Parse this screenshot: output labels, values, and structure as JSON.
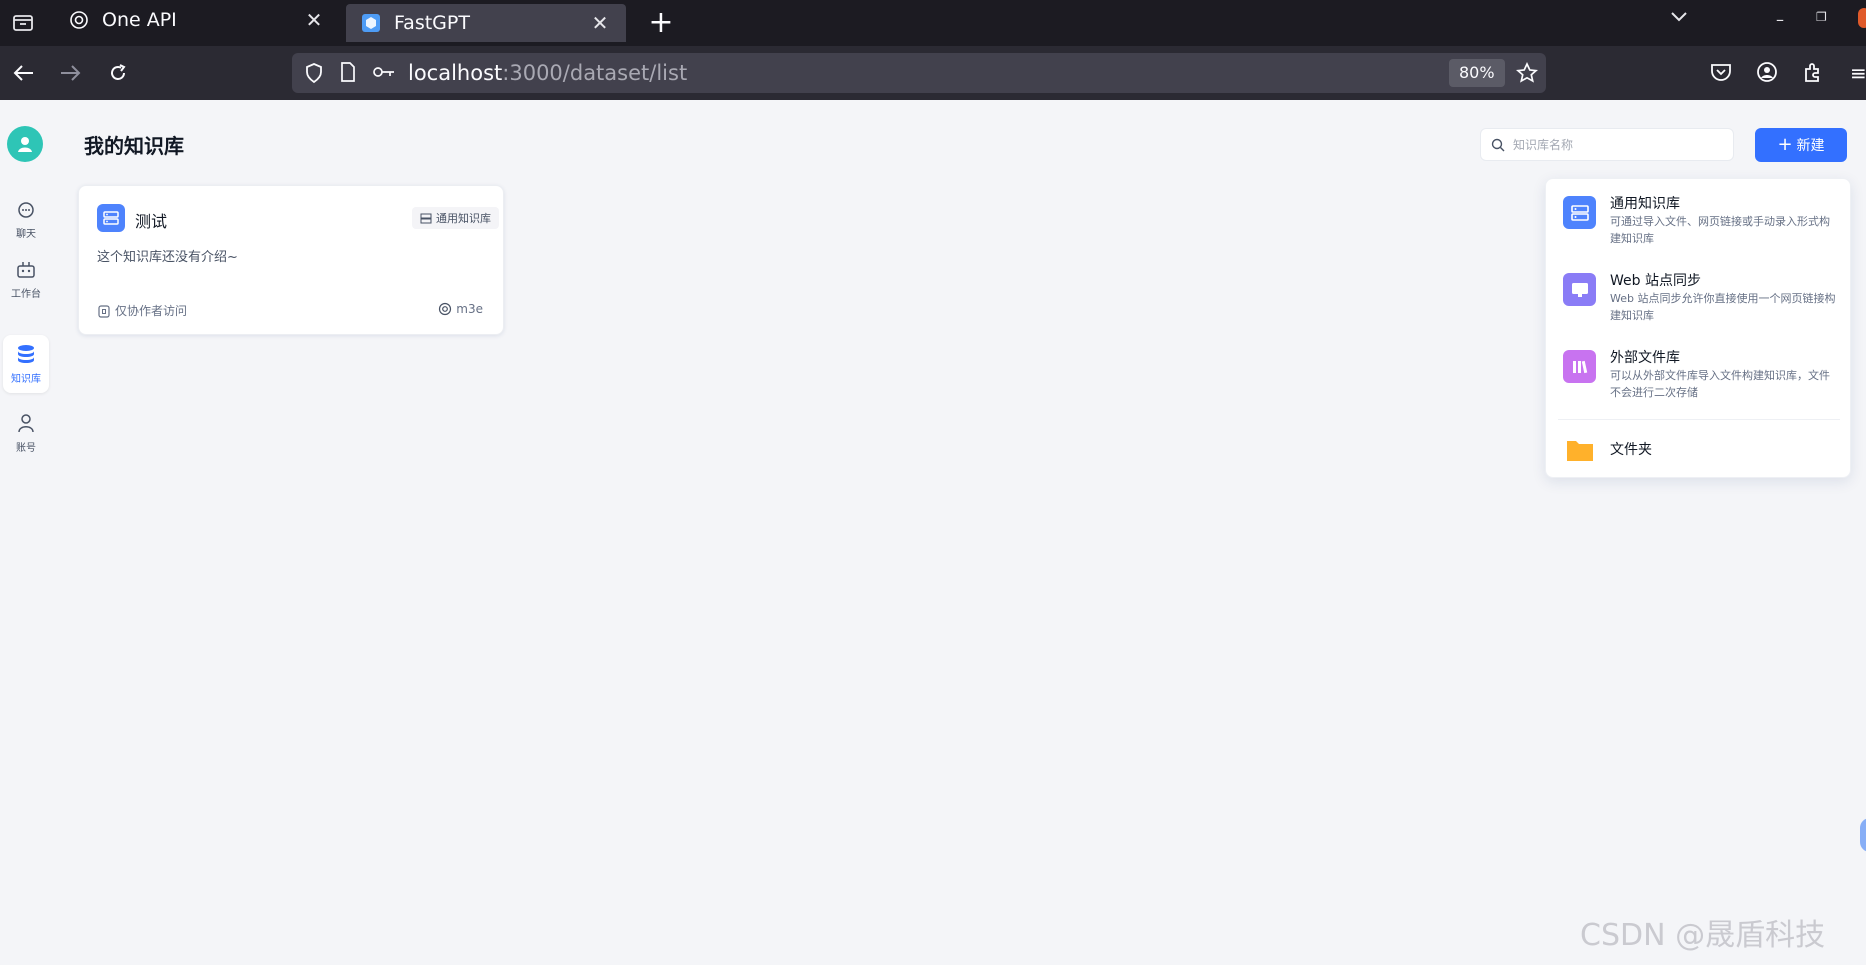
{
  "browser": {
    "tabs": [
      {
        "label": "One API",
        "icon": "openai-icon",
        "active": false
      },
      {
        "label": "FastGPT",
        "icon": "fastgpt-icon",
        "active": true
      }
    ],
    "url_host": "localhost",
    "url_path": ":3000/dataset/list",
    "zoom": "80%"
  },
  "sidebar": {
    "items": [
      {
        "label": "聊天",
        "icon": "chat-icon"
      },
      {
        "label": "工作台",
        "icon": "robot-icon"
      },
      {
        "label": "知识库",
        "icon": "database-icon",
        "active": true
      },
      {
        "label": "账号",
        "icon": "user-icon"
      }
    ]
  },
  "main": {
    "title": "我的知识库",
    "search_placeholder": "知识库名称",
    "new_button": "新建",
    "cards": [
      {
        "name": "测试",
        "tag": "通用知识库",
        "description": "这个知识库还没有介绍~",
        "permission": "仅协作者访问",
        "model": "m3e"
      }
    ]
  },
  "create_menu": {
    "items": [
      {
        "title": "通用知识库",
        "description": "可通过导入文件、网页链接或手动录入形式构建知识库",
        "icon": "dataset-icon",
        "color": "#4e83fd"
      },
      {
        "title": "Web 站点同步",
        "description": "Web 站点同步允许你直接使用一个网页链接构建知识库",
        "icon": "monitor-icon",
        "color": "#8a7cf6"
      },
      {
        "title": "外部文件库",
        "description": "可以从外部文件库导入文件构建知识库，文件不会进行二次存储",
        "icon": "library-icon",
        "color": "#c873f0"
      },
      {
        "title": "文件夹",
        "icon": "folder-icon",
        "color": "#ffb12b"
      }
    ]
  },
  "watermark": "CSDN @晟盾科技",
  "colors": {
    "primary": "#3370ff",
    "avatar": "#2ec5b6",
    "tab_bar": "#1c1b22",
    "nav_bar": "#2b2a33"
  }
}
